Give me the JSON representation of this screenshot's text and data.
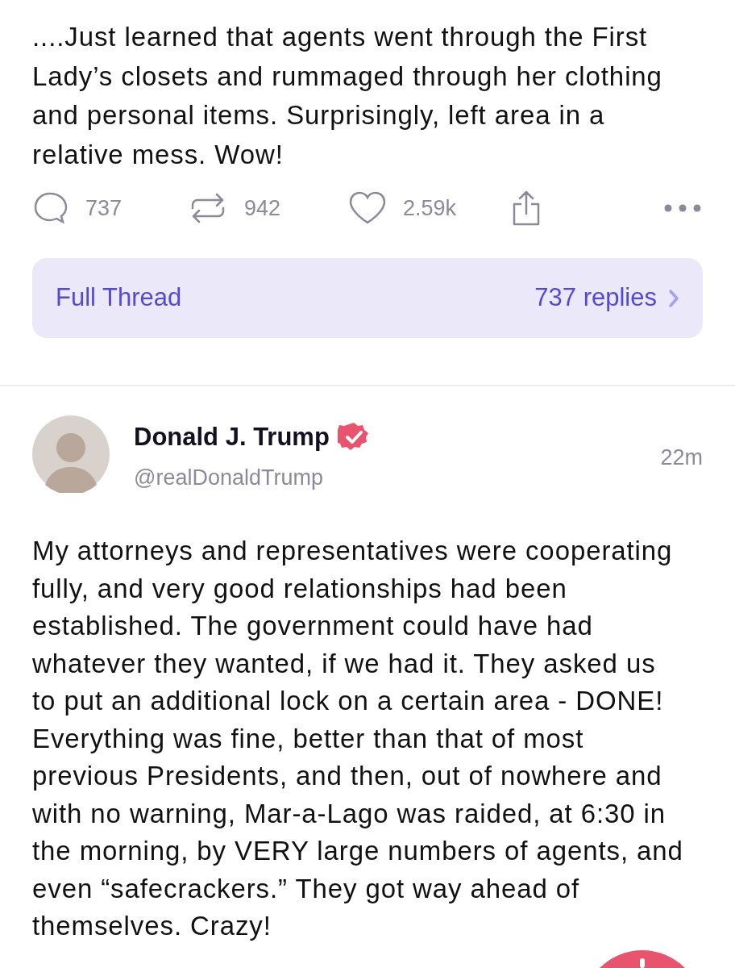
{
  "previous_post": {
    "text_lines": [
      "....Just learned that agents went through the First",
      "Lady’s closets and rummaged through her clothing",
      "and personal items. Surprisingly, left area in a",
      "relative mess. Wow!"
    ],
    "actions": {
      "replies": "737",
      "reposts": "942",
      "likes": "2.59k"
    }
  },
  "thread_link": {
    "label": "Full Thread",
    "replies": "737 replies"
  },
  "post": {
    "author": {
      "name": "Donald J. Trump",
      "verified": true,
      "handle": "@realDonaldTrump"
    },
    "time": "22m",
    "text_lines": [
      "My attorneys and representatives were cooperating",
      "fully, and very good relationships had been",
      "established. The government could have had",
      "whatever they wanted, if we had it. They asked us",
      "to put an additional lock on a certain area - DONE!",
      "Everything was fine, better than that of most",
      "previous Presidents, and then, out of nowhere and",
      "with no warning, Mar-a-Lago was raided, at 6:30 in",
      "the morning, by VERY large numbers of agents, and",
      "even “safecrackers.” They got way ahead of",
      "themselves. Crazy!"
    ]
  }
}
